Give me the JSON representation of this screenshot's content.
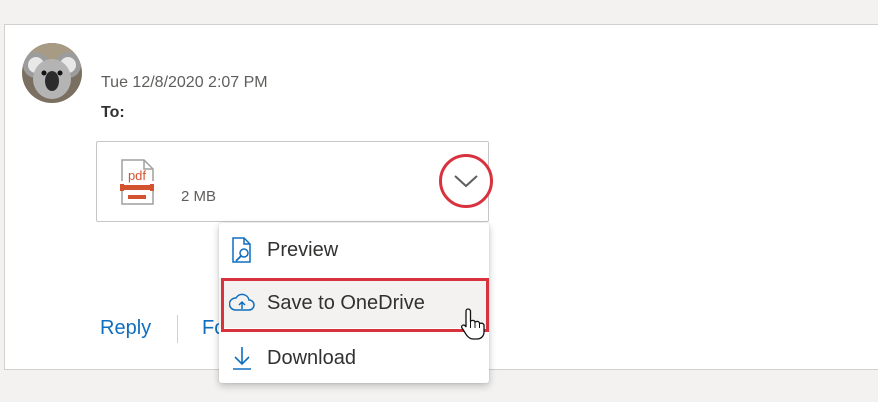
{
  "message": {
    "date": "Tue 12/8/2020 2:07 PM",
    "to_label": "To:"
  },
  "attachment": {
    "icon_text": "pdf",
    "size": "2 MB",
    "icon": "pdf-file-icon",
    "more_icon": "chevron-down-icon"
  },
  "actions": {
    "reply": "Reply",
    "forward": "Forward"
  },
  "menu": {
    "items": [
      {
        "label": "Preview",
        "icon": "preview-icon"
      },
      {
        "label": "Save to OneDrive",
        "icon": "cloud-upload-icon"
      },
      {
        "label": "Download",
        "icon": "download-icon"
      }
    ]
  },
  "colors": {
    "accent": "#106ebe",
    "highlight": "#d9323f",
    "pdf": "#d35230"
  }
}
